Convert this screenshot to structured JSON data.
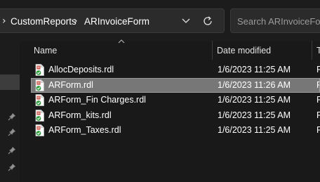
{
  "breadcrumb": {
    "lead_glyph": "›",
    "items": [
      "CustomReports",
      "ARInvoiceForm"
    ],
    "separator": "›"
  },
  "search": {
    "placeholder": "Search ARInvoiceForm"
  },
  "columns": {
    "name": "Name",
    "date_modified": "Date modified",
    "type": "T"
  },
  "files": [
    {
      "name": "AllocDeposits.rdl",
      "date": "1/6/2023 11:25 AM",
      "type": "F",
      "selected": false
    },
    {
      "name": "ARForm.rdl",
      "date": "1/6/2023 11:26 AM",
      "type": "F",
      "selected": true
    },
    {
      "name": "ARForm_Fin Charges.rdl",
      "date": "1/6/2023 11:25 AM",
      "type": "F",
      "selected": false
    },
    {
      "name": "ARForm_kits.rdl",
      "date": "1/6/2023 11:25 AM",
      "type": "F",
      "selected": false
    },
    {
      "name": "ARForm_Taxes.rdl",
      "date": "1/6/2023 11:25 AM",
      "type": "F",
      "selected": false
    }
  ],
  "icons": {
    "file": "rdl-file-icon",
    "overlay": "sync-checkmark-overlay",
    "pin": "pin-icon",
    "dropdown": "chevron-down-icon",
    "refresh": "refresh-icon",
    "sort": "sort-ascending-icon"
  },
  "colors": {
    "background": "#191919",
    "selection": "#777777",
    "file_icon_red": "#c0392b",
    "check_green": "#2e9e3e"
  }
}
